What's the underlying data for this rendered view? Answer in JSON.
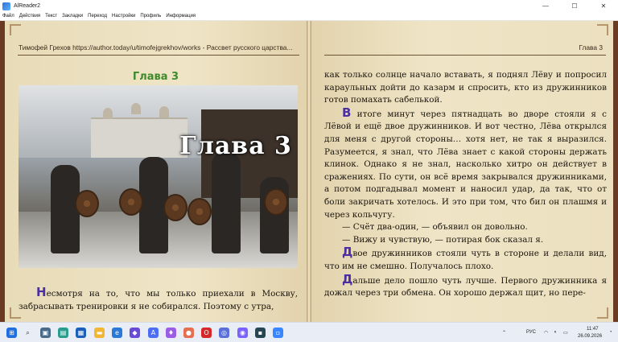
{
  "window": {
    "title": "AlReader2",
    "minimize": "—",
    "maximize": "☐",
    "close": "✕"
  },
  "menu": [
    "Файл",
    "Действия",
    "Текст",
    "Закладки",
    "Переход",
    "Настройки",
    "Профиль",
    "Информация"
  ],
  "left_page": {
    "running_head": "Тимофей Грехов https://author.today/u/timofejgrekhov/works - Рассвет русского царства...",
    "chapter_title": "Глава 3",
    "image_caption": "Глава 3",
    "para1_cap": "Н",
    "para1_text": "есмотря на то, что мы только приехали в Москву, забрасывать тренировки я не собирался. Поэтому с утра,"
  },
  "right_page": {
    "running_head": "Глава 3",
    "p1": "как только солнце начало вставать, я поднял Лёву и попросил караульных дойти до казарм и спросить, кто из дружинников готов помахать сабелькой.",
    "p2_cap": "В",
    "p2": " итоге минут через пятнадцать во дворе стояли я с Лёвой и ещё двое дружинников. И вот честно, Лёва открылся для меня с другой стороны… хотя нет, не так я выразился. Разумеется, я знал, что Лёва знает с какой стороны держать клинок. Однако я не знал, насколько хитро он действует в сражениях. По сути, он всё время закрывался дружинниками, а потом подгадывал момент и наносил удар, да так, что от боли закричать хотелось. И это при том, что бил он плашмя и через кольчугу.",
    "d1": "— Счёт два-один, — объявил он довольно.",
    "d2": "— Вижу и чувствую, — потирая бок сказал я.",
    "p3_cap": "Д",
    "p3": "вое дружинников стояли чуть в стороне и делали вид, что им не смешно. Получалось плохо.",
    "p4_cap": "Д",
    "p4": "альше дело пошло чуть лучше. Первого дружинника я дожал через три обмена. Он хорошо держал щит, но пере-"
  },
  "taskbar": {
    "lang": "РУС",
    "time": "11:47",
    "date": "26.09.2026"
  }
}
